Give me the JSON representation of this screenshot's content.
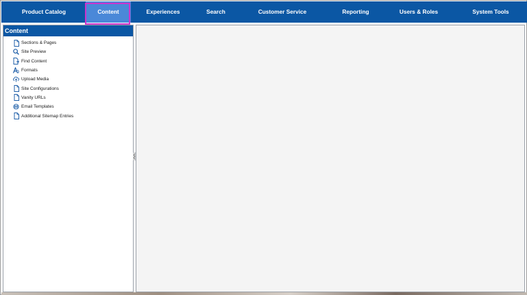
{
  "topnav": {
    "items": [
      {
        "label": "Product Catalog",
        "active": false
      },
      {
        "label": "Content",
        "active": true
      },
      {
        "label": "Experiences",
        "active": false
      },
      {
        "label": "Search",
        "active": false
      },
      {
        "label": "Customer Service",
        "active": false
      },
      {
        "label": "Reporting",
        "active": false
      },
      {
        "label": "Users & Roles",
        "active": false
      },
      {
        "label": "System Tools",
        "active": false
      }
    ]
  },
  "sidebar": {
    "title": "Content",
    "items": [
      {
        "label": "Sections & Pages",
        "icon": "document-icon"
      },
      {
        "label": "Site Preview",
        "icon": "magnifier-icon"
      },
      {
        "label": "Find Content",
        "icon": "document-arrow-icon"
      },
      {
        "label": "Formats",
        "icon": "font-format-icon"
      },
      {
        "label": "Upload Media",
        "icon": "cloud-upload-icon"
      },
      {
        "label": "Site Configurations",
        "icon": "document-icon"
      },
      {
        "label": "Vanity URLs",
        "icon": "document-icon"
      },
      {
        "label": "Email Templates",
        "icon": "envelope-icon"
      },
      {
        "label": "Additional Sitemap Entries",
        "icon": "document-icon"
      }
    ]
  },
  "colors": {
    "nav_bg": "#0b57a4",
    "nav_active_bg": "#4a88d8",
    "highlight": "#cc33cc",
    "icon": "#1f5fa8"
  }
}
